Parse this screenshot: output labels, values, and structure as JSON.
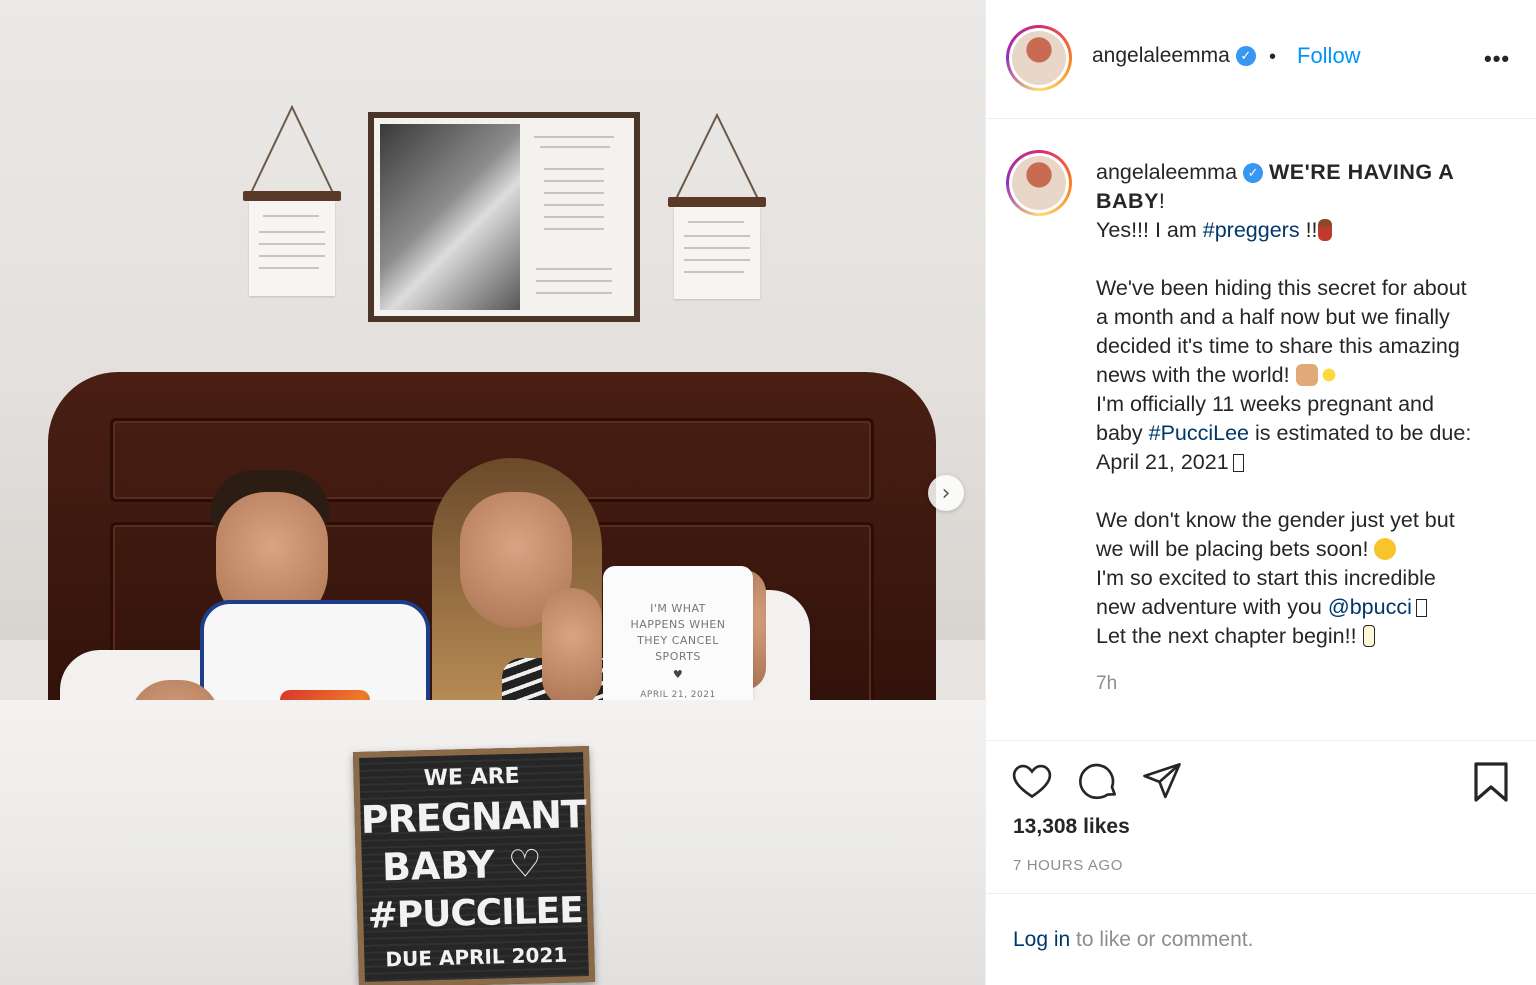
{
  "post": {
    "username": "angelaleemma",
    "follow_label": "Follow",
    "separator": "•",
    "more_label": "•••"
  },
  "photo": {
    "letterboard_lines": [
      "WE  ARE",
      "PREGNANT",
      "BABY ♡",
      "#PUCCILEE",
      "DUE APRIL 2021"
    ],
    "onesie_lines": [
      "I'M WHAT",
      "HAPPENS WHEN",
      "THEY CANCEL",
      "SPORTS",
      "♥",
      "APRIL 21, 2021"
    ],
    "next_icon": "›"
  },
  "caption": {
    "username": "angelaleemma",
    "headline_1": "WE'RE HAVING A",
    "headline_2": "BABY",
    "headline_2_tail": "!",
    "l1_pre": "Yes!!! I am ",
    "l1_tag": "#preggers",
    "l1_post": " !!",
    "p1": "We've been hiding this secret for about",
    "p2": "a month and a half now but we finally",
    "p3": "decided it's time to share this amazing",
    "p4": "news with the world! ",
    "p5": "I'm officially 11 weeks pregnant and",
    "p6_pre": "baby ",
    "p6_tag": "#PucciLee",
    "p6_post": " is estimated to be due:",
    "p7": "April 21, 2021",
    "q1": "We don't know the gender just yet but",
    "q2": "we will be placing bets soon! ",
    "q3": "I'm so excited to start this incredible",
    "q4_pre": "new adventure with you ",
    "q4_mention": "@bpucci",
    "q5": "Let the next chapter begin!! ",
    "time": "7h"
  },
  "engagement": {
    "likes": "13,308 likes",
    "posted_ago": "7 HOURS AGO",
    "login_link": "Log in",
    "login_tail": " to like or comment."
  },
  "icons": {
    "like": "heart-icon",
    "comment": "comment-icon",
    "share": "paper-plane-icon",
    "save": "bookmark-icon",
    "verified": "verified-badge-icon"
  },
  "colors": {
    "link": "#0095f6",
    "hashtag": "#00376b",
    "muted": "#8e8e8e",
    "verified": "#3897f0"
  }
}
